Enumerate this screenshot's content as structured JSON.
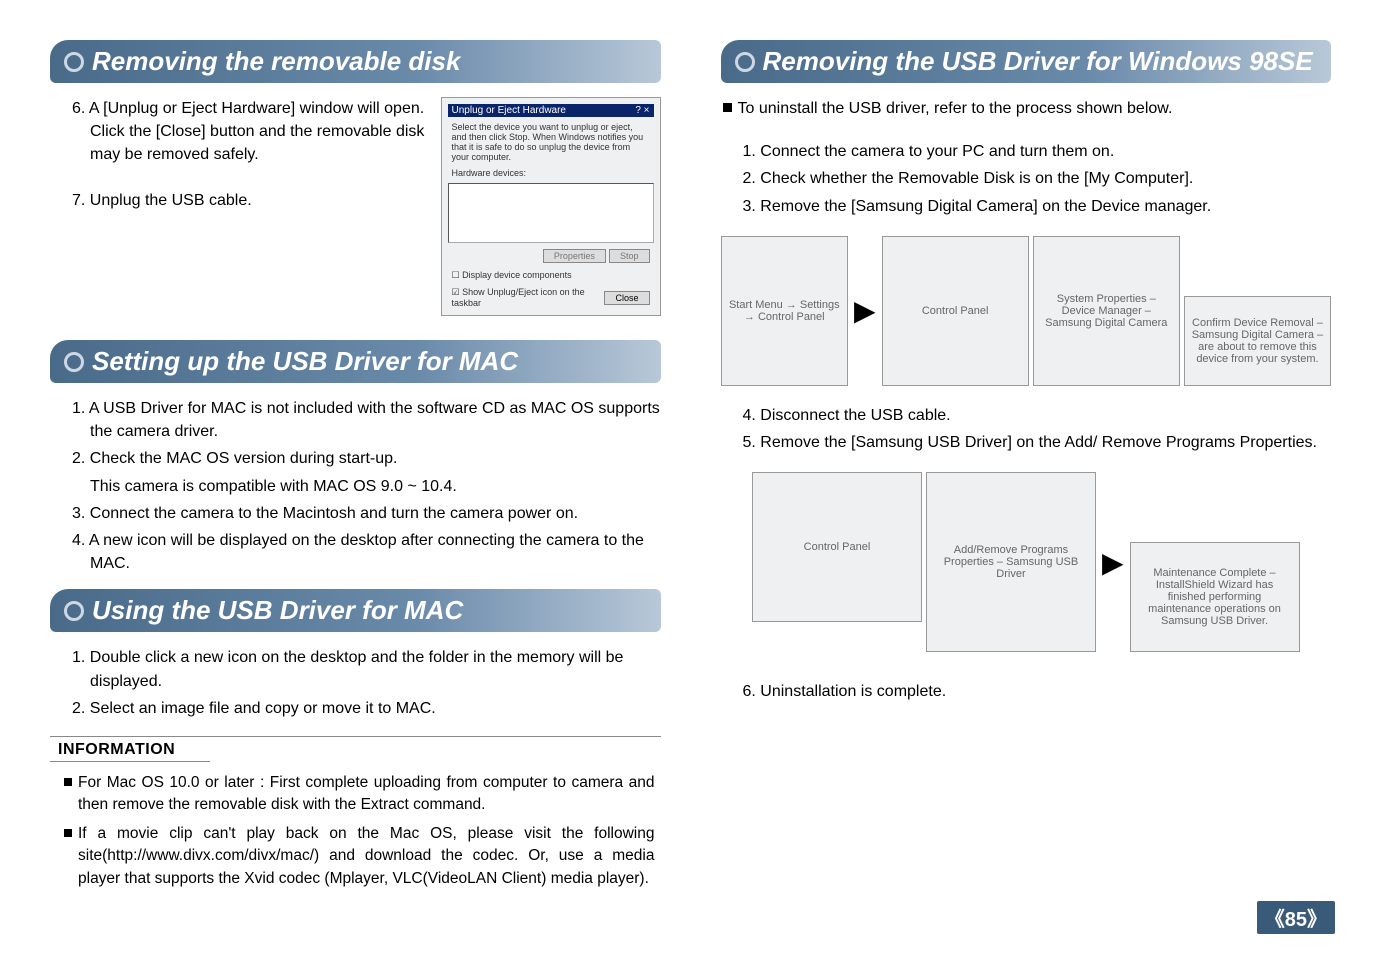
{
  "left": {
    "h1": "Removing the removable disk",
    "step6": "6. A [Unplug or Eject Hardware] window will open. Click the [Close] button and the removable disk may be removed safely.",
    "step7": "7. Unplug the USB cable.",
    "dialog1": {
      "title": "Unplug or Eject Hardware",
      "hint": "Select the device you want to unplug or eject, and then click Stop. When Windows notifies you that it is safe to do so unplug the device from your computer.",
      "hw_label": "Hardware devices:",
      "btn_properties": "Properties",
      "btn_stop": "Stop",
      "chk1": "Display device components",
      "chk2": "Show Unplug/Eject icon on the taskbar",
      "btn_close": "Close"
    },
    "h2": "Setting up the USB Driver for MAC",
    "mac_setup": [
      "1. A USB Driver for MAC is not included with the software CD as MAC OS supports the camera driver.",
      "2. Check the MAC OS version during start-up.",
      "2sub. This camera is compatible with MAC OS 9.0 ~ 10.4.",
      "3. Connect the camera to the Macintosh and turn the camera power on.",
      "4. A new icon will be displayed on the desktop after connecting the camera to the MAC."
    ],
    "h3": "Using the USB Driver for MAC",
    "mac_use": [
      "1. Double click a new icon on the desktop and the folder in the memory will be displayed.",
      "2. Select an image file and copy or move it to MAC."
    ],
    "info_title": "INFORMATION",
    "info_items": [
      "For Mac OS 10.0 or later : First complete uploading from computer to camera and then remove the removable disk with the Extract command.",
      "If a movie clip can't play back on the Mac OS, please visit the following site(http://www.divx.com/divx/mac/) and download the codec. Or, use a media player that supports the Xvid codec (Mplayer, VLC(VideoLAN Client) media player)."
    ]
  },
  "right": {
    "h1": "Removing the USB Driver for Windows 98SE",
    "intro": "To uninstall the USB driver, refer to the process shown below.",
    "steps_a": [
      "1. Connect the camera to your PC and turn them on.",
      "2. Check whether the Removable Disk is on the [My Computer].",
      "3. Remove the [Samsung Digital Camera] on the Device manager."
    ],
    "screens1": {
      "a": "Start Menu → Settings → Control Panel",
      "b": "Control Panel",
      "c": "System Properties – Device Manager – Samsung Digital Camera",
      "d": "Confirm Device Removal – Samsung Digital Camera – are about to remove this device from your system."
    },
    "steps_b": [
      "4. Disconnect the USB cable.",
      "5. Remove the [Samsung USB Driver] on the Add/ Remove Programs Properties."
    ],
    "screens2": {
      "a": "Control Panel",
      "b": "Add/Remove Programs Properties – Samsung USB Driver",
      "c": "Maintenance Complete – InstallShield Wizard has finished performing maintenance operations on Samsung USB Driver."
    },
    "step6": "6. Uninstallation is complete."
  },
  "page_number": "《85》"
}
